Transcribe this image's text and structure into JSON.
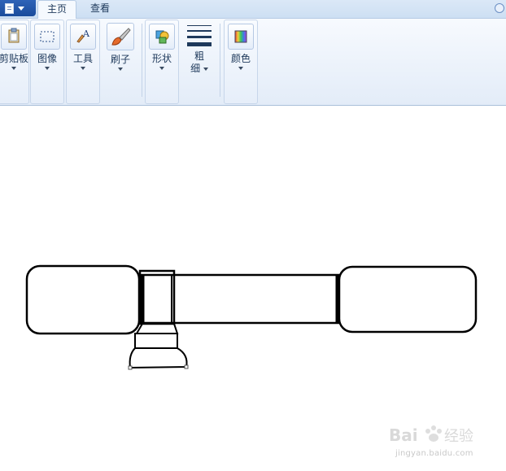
{
  "tabs": [
    {
      "label": "主页",
      "active": true
    },
    {
      "label": "查看",
      "active": false
    }
  ],
  "ribbon": {
    "clipboard": {
      "label": "剪贴板",
      "icon": "clipboard-icon"
    },
    "image": {
      "label": "图像",
      "icon": "select-icon"
    },
    "tools": {
      "label": "工具",
      "icon": "tools-icon"
    },
    "brush": {
      "label": "刷子",
      "icon": "brush-icon"
    },
    "shapes": {
      "label": "形状",
      "icon": "shapes-icon"
    },
    "size": {
      "label_line1": "粗",
      "label_line2": "细",
      "icon": "line-width-icon"
    },
    "colors": {
      "label": "颜色",
      "icon": "colors-icon"
    }
  },
  "colors": {
    "accent": "#1a4b9b",
    "stroke": "#000000",
    "tab_text": "#1e395b"
  },
  "watermark": {
    "brand": "Bai 经验",
    "url": "jingyan.baidu.com"
  }
}
